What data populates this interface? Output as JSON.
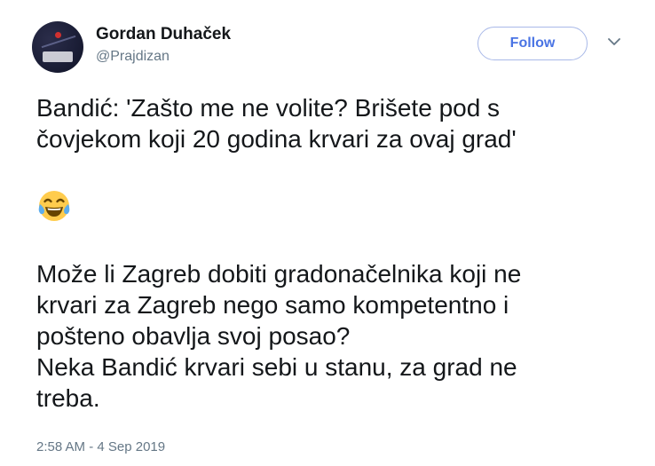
{
  "author": {
    "name": "Gordan Duhaček",
    "handle": "@Prajdizan"
  },
  "follow_label": "Follow",
  "tweet": {
    "paragraph1": [
      "Bandić: 'Zašto me ne volite? Brišete pod s",
      "čovjekom koji 20 godina krvari za ovaj grad'"
    ],
    "emoji": "face-with-tears-of-joy",
    "paragraph3": [
      "Može li Zagreb dobiti gradonačelnika koji ne",
      "krvari za Zagreb nego samo kompetentno i",
      "pošteno obavlja svoj posao?",
      "Neka Bandić krvari sebi u stanu, za grad ne",
      "treba."
    ]
  },
  "timestamp": "2:58 AM - 4 Sep 2019",
  "colors": {
    "text": "#14171a",
    "secondary": "#657786",
    "accent": "#4a74e4",
    "button_border": "#a9b9e8"
  }
}
